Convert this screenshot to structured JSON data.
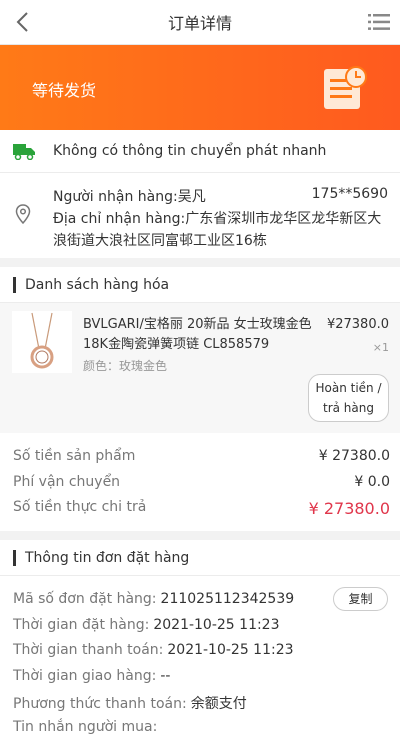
{
  "header": {
    "title": "订单详情"
  },
  "status": {
    "text": "等待发货",
    "gradient": [
      "#ff7a17",
      "#ff5a1f"
    ]
  },
  "delivery": {
    "no_info": "Không có thông tin chuyển phát nhanh",
    "receiver_label": "Người nhận hàng:",
    "receiver_name": "吴凡",
    "phone": "175**5690",
    "address_label": "Địa chỉ nhận hàng:",
    "address": "广东省深圳市龙华区龙华新区大浪街道大浪社区同富邨工业区16栋"
  },
  "goods": {
    "section_title": "Danh sách hàng hóa",
    "item": {
      "name": "BVLGARI/宝格丽 20新品 女士玫瑰金色18K金陶瓷弹簧项链 CL858579",
      "attr": "颜色：玫瑰金色",
      "price": "¥27380.0",
      "qty": "×1",
      "refund_button": [
        "Hoàn tiền /",
        "trả hàng"
      ]
    },
    "summary": [
      {
        "label": "Số tiền sản phẩm",
        "value": "¥ 27380.0"
      },
      {
        "label": "Phí vận chuyển",
        "value": "¥ 0.0"
      },
      {
        "label": "Số tiền thực chi trả",
        "value": "¥ 27380.0"
      }
    ]
  },
  "order": {
    "section_title": "Thông tin đơn đặt hàng",
    "copy_button": "复制",
    "rows": [
      {
        "label": "Mã số đơn đặt hàng:",
        "value": "211025112342539"
      },
      {
        "label": "Thời gian đặt hàng:",
        "value": "2021-10-25 11:23"
      },
      {
        "label": "Thời gian thanh toán:",
        "value": "2021-10-25 11:23"
      },
      {
        "label": "Thời gian giao hàng:",
        "value": "--"
      },
      {
        "label": "Phương thức thanh toán:",
        "value": "余额支付"
      },
      {
        "label": "Tin nhắn người mua:",
        "value": ""
      }
    ]
  },
  "colors": {
    "accent": "#ff6a1a",
    "price_red": "#e0364b",
    "ship_green": "#2aa33a"
  }
}
